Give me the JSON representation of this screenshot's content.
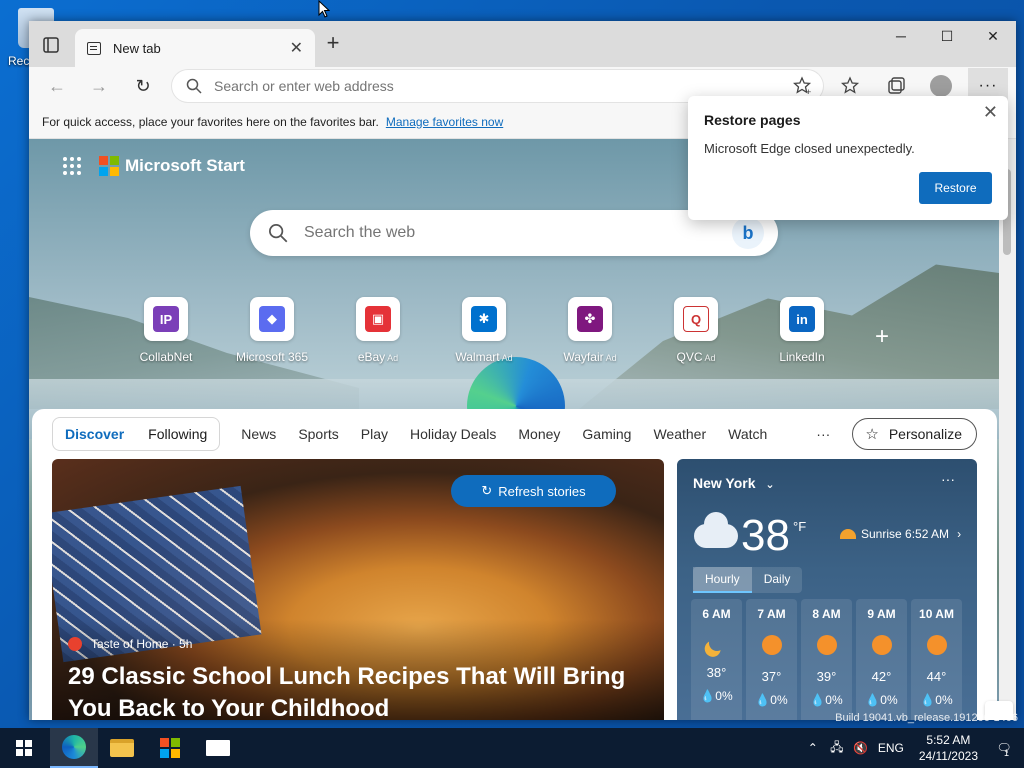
{
  "desktop": {
    "recycle_bin_label": "Rec"
  },
  "browser": {
    "tab": {
      "title": "New tab"
    },
    "address_placeholder": "Search or enter web address",
    "favorites_bar": {
      "message": "For quick access, place your favorites here on the favorites bar.",
      "link": "Manage favorites now"
    }
  },
  "popup": {
    "title": "Restore pages",
    "message": "Microsoft Edge closed unexpectedly.",
    "button": "Restore"
  },
  "start_page": {
    "brand": "Microsoft Start",
    "search_placeholder": "Search the web",
    "quicklinks": [
      {
        "name": "CollabNet",
        "ad": "",
        "color": "#7b3fb8",
        "glyph": "IP"
      },
      {
        "name": "Microsoft 365",
        "ad": "",
        "color": "#5b6cf0",
        "glyph": "◆"
      },
      {
        "name": "eBay",
        "ad": "Ad",
        "color": "#e53238",
        "glyph": "▣"
      },
      {
        "name": "Walmart",
        "ad": "Ad",
        "color": "#0071ce",
        "glyph": "✱"
      },
      {
        "name": "Wayfair",
        "ad": "Ad",
        "color": "#7f187f",
        "glyph": "✤"
      },
      {
        "name": "QVC",
        "ad": "Ad",
        "color": "#ffffff",
        "glyph": "Q"
      },
      {
        "name": "LinkedIn",
        "ad": "",
        "color": "#0a66c2",
        "glyph": "in"
      }
    ],
    "feed_nav": {
      "discover": "Discover",
      "following": "Following",
      "categories": [
        "News",
        "Sports",
        "Play",
        "Holiday Deals",
        "Money",
        "Gaming",
        "Weather",
        "Watch"
      ],
      "more": "···",
      "personalize": "Personalize"
    },
    "story": {
      "refresh": "Refresh stories",
      "source": "Taste of Home · 5h",
      "headline": "29 Classic School Lunch Recipes That Will Bring You Back to Your Childhood"
    },
    "weather": {
      "city": "New York",
      "menu": "···",
      "temp": "38",
      "unit": "°F",
      "sunrise": "Sunrise 6:52 AM",
      "tabs": [
        "Hourly",
        "Daily"
      ],
      "hours": [
        {
          "time": "6 AM",
          "temp": "38°",
          "precip": "0%",
          "icon": "moon"
        },
        {
          "time": "7 AM",
          "temp": "37°",
          "precip": "0%",
          "icon": "sun"
        },
        {
          "time": "8 AM",
          "temp": "39°",
          "precip": "0%",
          "icon": "sun"
        },
        {
          "time": "9 AM",
          "temp": "42°",
          "precip": "0%",
          "icon": "sun"
        },
        {
          "time": "10 AM",
          "temp": "44°",
          "precip": "0%",
          "icon": "sun"
        }
      ]
    }
  },
  "system": {
    "build": "Build 19041.vb_release.191206-1406",
    "language": "ENG",
    "time": "5:52 AM",
    "date": "24/11/2023",
    "notifications": "1"
  }
}
